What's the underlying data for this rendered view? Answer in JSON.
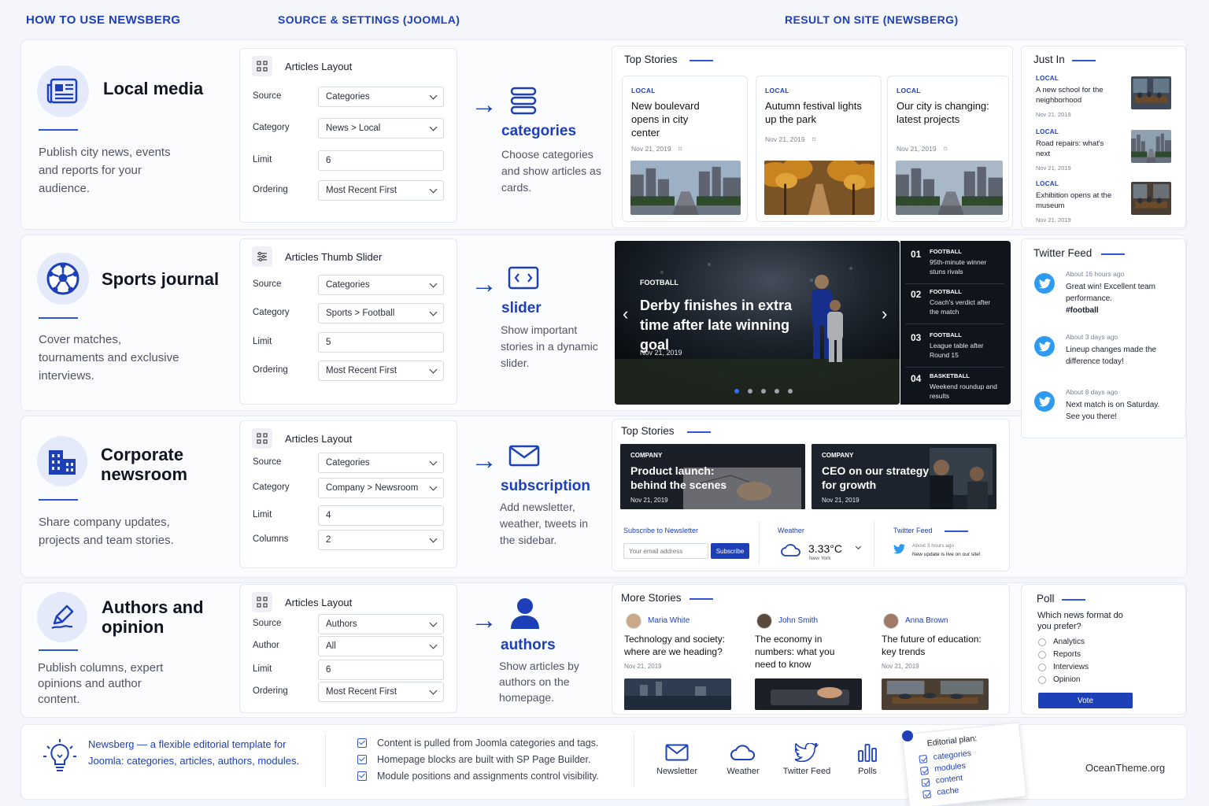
{
  "headers": {
    "how": "HOW TO USE NEWSBERG",
    "source": "SOURCE & SETTINGS (JOOMLA)",
    "result": "RESULT ON SITE (NEWSBERG)"
  },
  "rows": [
    {
      "title": "Local media",
      "desc": "Publish city news, events and reports for your audience.",
      "panel": "Articles Layout",
      "fields": [
        {
          "label": "Source",
          "value": "Categories",
          "select": true
        },
        {
          "label": "Category",
          "value": "News > Local",
          "select": true
        },
        {
          "label": "Limit",
          "value": "6",
          "select": false
        },
        {
          "label": "Ordering",
          "value": "Most Recent First",
          "select": true
        }
      ],
      "feature": "categories",
      "fdesc": "Choose categories and show articles as cards."
    },
    {
      "title": "Sports journal",
      "desc": "Cover matches, tournaments and exclusive interviews.",
      "panel": "Articles Thumb Slider",
      "fields": [
        {
          "label": "Source",
          "value": "Categories",
          "select": true
        },
        {
          "label": "Category",
          "value": "Sports > Football",
          "select": true
        },
        {
          "label": "Limit",
          "value": "5",
          "select": false
        },
        {
          "label": "Ordering",
          "value": "Most Recent First",
          "select": true
        }
      ],
      "feature": "slider",
      "fdesc": "Show important stories in a dynamic slider."
    },
    {
      "title": "Corporate newsroom",
      "desc": "Share company updates, projects and team stories.",
      "panel": "Articles Layout",
      "fields": [
        {
          "label": "Source",
          "value": "Categories",
          "select": true
        },
        {
          "label": "Category",
          "value": "Company > Newsroom",
          "select": true
        },
        {
          "label": "Limit",
          "value": "4",
          "select": false
        },
        {
          "label": "Columns",
          "value": "2",
          "select": true
        }
      ],
      "feature": "subscription",
      "fdesc": "Add newsletter, weather, tweets in the sidebar."
    },
    {
      "title": "Authors and opinion",
      "desc": "Publish columns, expert opinions and author content.",
      "panel": "Articles Layout",
      "fields": [
        {
          "label": "Source",
          "value": "Authors",
          "select": true
        },
        {
          "label": "Author",
          "value": "All",
          "select": true
        },
        {
          "label": "Limit",
          "value": "6",
          "select": false
        },
        {
          "label": "Ordering",
          "value": "Most Recent First",
          "select": true
        }
      ],
      "feature": "authors",
      "fdesc": "Show articles by authors on the homepage."
    }
  ],
  "top1": {
    "title": "Top Stories",
    "cards": [
      {
        "tag": "LOCAL",
        "headline": "New boulevard opens in city center",
        "date": "Nov 21, 2019"
      },
      {
        "tag": "LOCAL",
        "headline": "Autumn festival lights up the park",
        "date": "Nov 21, 2019"
      },
      {
        "tag": "LOCAL",
        "headline": "Our city is changing: latest projects",
        "date": "Nov 21, 2019"
      }
    ]
  },
  "justin": {
    "title": "Just In",
    "items": [
      {
        "tag": "LOCAL",
        "headline": "A new school for the neighborhood",
        "date": "Nov 21, 2019"
      },
      {
        "tag": "LOCAL",
        "headline": "Road repairs: what's next",
        "date": "Nov 21, 2019"
      },
      {
        "tag": "LOCAL",
        "headline": "Exhibition opens at the museum",
        "date": "Nov 21, 2019"
      }
    ]
  },
  "slider": {
    "tag": "FOOTBALL",
    "headline": "Derby finishes in extra time after late winning goal",
    "date": "Nov 21, 2019",
    "active_dot": 1,
    "dots": 5,
    "list": [
      {
        "num": "01",
        "tag": "FOOTBALL",
        "text": "95th-minute winner stuns rivals"
      },
      {
        "num": "02",
        "tag": "FOOTBALL",
        "text": "Coach's verdict after the match"
      },
      {
        "num": "03",
        "tag": "FOOTBALL",
        "text": "League table after Round 15"
      },
      {
        "num": "04",
        "tag": "BASKETBALL",
        "text": "Weekend roundup and results"
      }
    ]
  },
  "twitter": {
    "title": "Twitter Feed",
    "items": [
      {
        "time": "About 16 hours ago",
        "text": "Great win! Excellent team performance.",
        "hashtag": "#football"
      },
      {
        "time": "About 3 days ago",
        "text": "Lineup changes made the difference today!",
        "hashtag": ""
      },
      {
        "time": "About 8 days ago",
        "text": "Next match is on Saturday. See you there!",
        "hashtag": ""
      }
    ]
  },
  "top2": {
    "title": "Top Stories",
    "cards": [
      {
        "tag": "COMPANY",
        "headline": "Product launch: behind the scenes",
        "date": "Nov 21, 2019"
      },
      {
        "tag": "COMPANY",
        "headline": "CEO on our strategy for growth",
        "date": "Nov 21, 2019"
      }
    ]
  },
  "newsletter": {
    "title": "Subscribe to Newsletter",
    "placeholder": "Your email address",
    "button": "Subscribe"
  },
  "weather": {
    "title": "Weather",
    "temp": "3.33°C",
    "city": "New York"
  },
  "tw_small": {
    "title": "Twitter Feed",
    "time": "About 3 hours ago",
    "text": "New update is live on our site!"
  },
  "more": {
    "title": "More Stories",
    "items": [
      {
        "author": "Maria White",
        "headline": "Technology and society: where are we heading?",
        "date": "Nov 21, 2019"
      },
      {
        "author": "John Smith",
        "headline": "The economy in numbers: what you need to know",
        "date": "Nov 21, 2019"
      },
      {
        "author": "Anna Brown",
        "headline": "The future of education: key trends",
        "date": "Nov 21, 2019"
      }
    ]
  },
  "poll": {
    "title": "Poll",
    "question": "Which news format do you prefer?",
    "options": [
      "Analytics",
      "Reports",
      "Interviews",
      "Opinion"
    ],
    "button": "Vote"
  },
  "footer": {
    "intro": "Newsberg — a flexible editorial template for Joomla: categories, articles, authors, modules.",
    "checks": [
      "Content is pulled from Joomla categories and tags.",
      "Homepage blocks are built with SP Page Builder.",
      "Module positions and assignments control visibility."
    ],
    "icons": [
      {
        "icon": "mail-icon",
        "label": "Newsletter"
      },
      {
        "icon": "cloud-icon",
        "label": "Weather"
      },
      {
        "icon": "twitter-icon",
        "label": "Twitter Feed"
      },
      {
        "icon": "bar-chart-icon",
        "label": "Polls"
      }
    ],
    "note_title": "Editorial plan:",
    "note_items": [
      "categories",
      "modules",
      "content",
      "cache"
    ],
    "brand": "OceanTheme.org"
  },
  "colors": {
    "accent": "#1d3fb8",
    "twitter": "#2e9bf0",
    "bg": "#f4f6fb"
  }
}
